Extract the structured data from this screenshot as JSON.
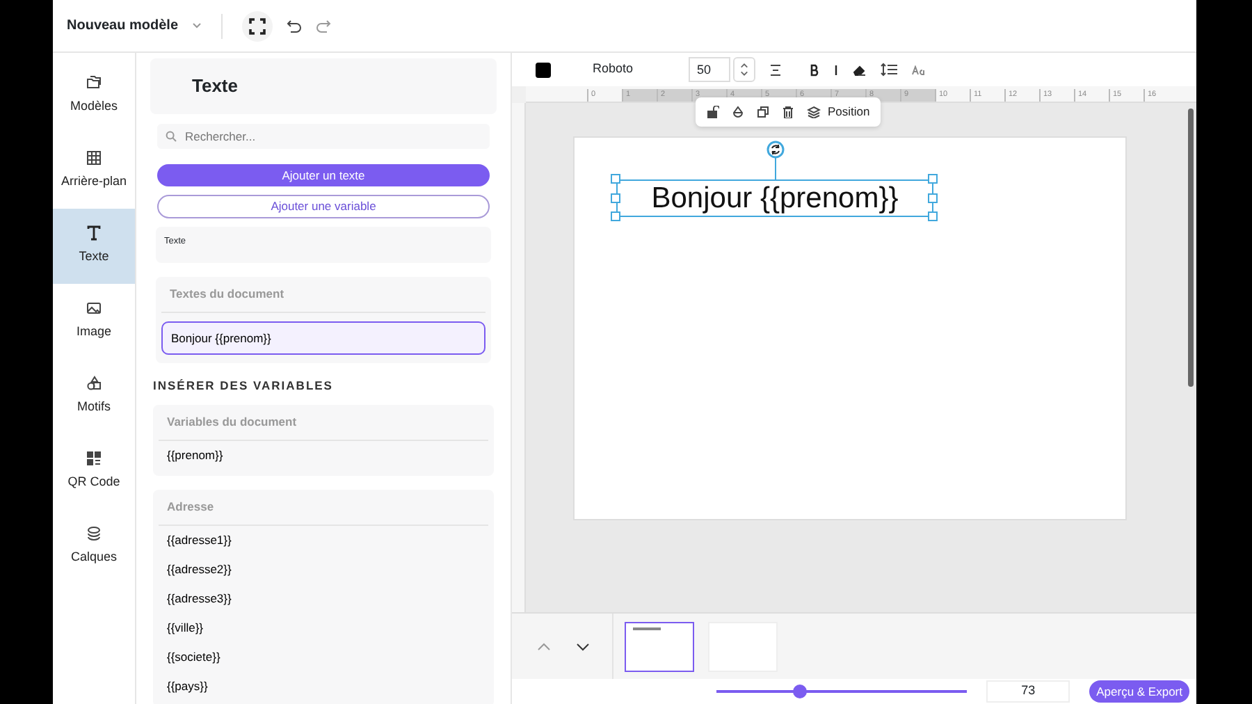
{
  "header": {
    "title": "Nouveau modèle"
  },
  "nav": [
    {
      "label": "Modèles",
      "selected": false
    },
    {
      "label": "Arrière-plan",
      "selected": false
    },
    {
      "label": "Texte",
      "selected": true
    },
    {
      "label": "Image",
      "selected": false
    },
    {
      "label": "Motifs",
      "selected": false
    },
    {
      "label": "QR Code",
      "selected": false
    },
    {
      "label": "Calques",
      "selected": false
    }
  ],
  "panel": {
    "title": "Texte",
    "search": {
      "placeholder": "Rechercher..."
    },
    "buttons": [
      {
        "label": "Ajouter un texte",
        "kind": "primary"
      },
      {
        "label": "Ajouter une variable",
        "kind": "outline"
      }
    ],
    "preset_label": "Texte",
    "document_texts": {
      "title": "Textes du document",
      "items": [
        {
          "text": "Bonjour {{prenom}}",
          "selected": true
        }
      ]
    },
    "variables_heading": "INSÉRER DES VARIABLES",
    "groups": [
      {
        "title": "Variables du document",
        "items": [
          "{{prenom}}"
        ]
      },
      {
        "title": "Adresse",
        "items": [
          "{{adresse1}}",
          "{{adresse2}}",
          "{{adresse3}}",
          "{{ville}}",
          "{{societe}}",
          "{{pays}}"
        ]
      }
    ]
  },
  "toolbar": {
    "color": "#000000",
    "font": "Roboto",
    "size": "50"
  },
  "ruler": [
    "0",
    "1",
    "2",
    "3",
    "4",
    "5",
    "6",
    "7",
    "8",
    "9",
    "10",
    "11",
    "12",
    "13",
    "14",
    "15",
    "16"
  ],
  "selection_menu": {
    "label": "Position"
  },
  "canvas": {
    "text": "Bonjour {{prenom}}"
  },
  "pages": [
    {
      "selected": true,
      "kind": "text"
    },
    {
      "selected": false,
      "kind": "blank"
    }
  ],
  "zoom": {
    "level": 0.33,
    "value": "73"
  },
  "export_button": "Aperçu & Export"
}
